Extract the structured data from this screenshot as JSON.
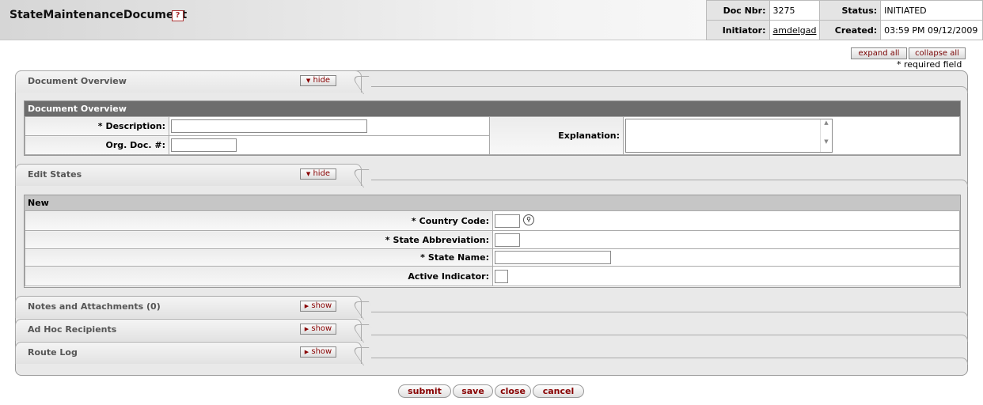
{
  "header": {
    "title": "StateMaintenanceDocument",
    "help_icon": "?",
    "doc_nbr_label": "Doc Nbr:",
    "doc_nbr": "3275",
    "status_label": "Status:",
    "status": "INITIATED",
    "initiator_label": "Initiator:",
    "initiator": "amdelgad",
    "created_label": "Created:",
    "created": "03:59 PM 09/12/2009"
  },
  "toolbar": {
    "expand_all": "expand all",
    "collapse_all": "collapse all",
    "required_note": "* required field"
  },
  "tabs": {
    "overview": {
      "title": "Document Overview",
      "toggle": "hide"
    },
    "edit_states": {
      "title": "Edit States",
      "toggle": "hide"
    },
    "notes": {
      "title": "Notes and Attachments (0)",
      "toggle": "show"
    },
    "adhoc": {
      "title": "Ad Hoc Recipients",
      "toggle": "show"
    },
    "route_log": {
      "title": "Route Log",
      "toggle": "show"
    }
  },
  "overview_section": {
    "header": "Document Overview",
    "description_label": "Description:",
    "description_value": "",
    "org_doc_label": "Org. Doc. #:",
    "org_doc_value": "",
    "explanation_label": "Explanation:",
    "explanation_value": ""
  },
  "edit_section": {
    "header": "New",
    "country_code_label": "Country Code:",
    "state_abbr_label": "State Abbreviation:",
    "state_name_label": "State Name:",
    "active_label": "Active Indicator:",
    "active_checked": false
  },
  "actions": {
    "submit": "submit",
    "save": "save",
    "close": "close",
    "cancel": "cancel"
  },
  "icons": {
    "lookup": "magnifier-icon",
    "hide_arrow": "▼",
    "show_arrow": "▶"
  },
  "required_marker": "*"
}
